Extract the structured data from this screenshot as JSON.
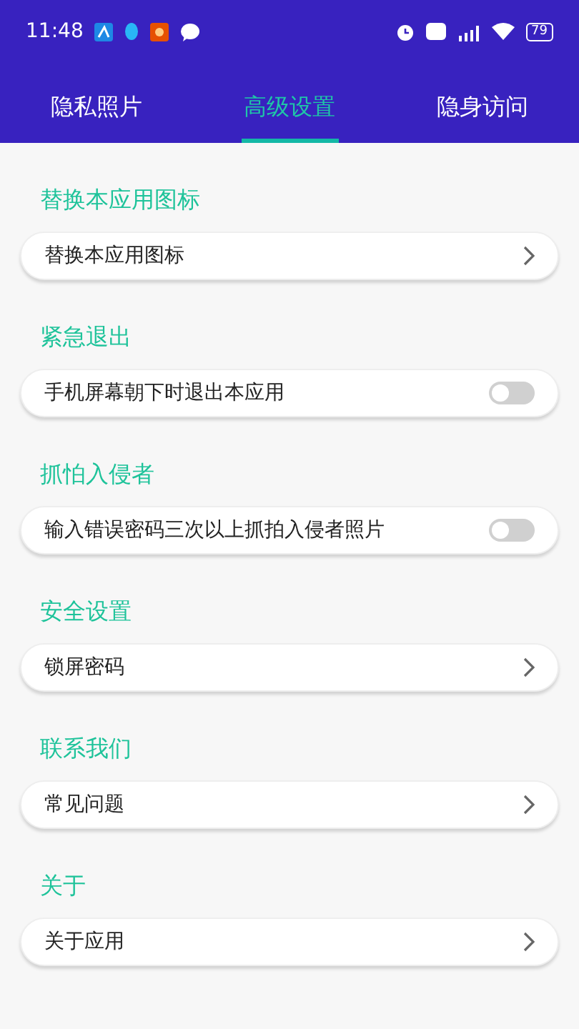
{
  "status_bar": {
    "time": "11:48",
    "battery": "79"
  },
  "tabs": [
    {
      "label": "隐私照片",
      "selected": false
    },
    {
      "label": "高级设置",
      "selected": true
    },
    {
      "label": "隐身访问",
      "selected": false
    }
  ],
  "sections": [
    {
      "title": "替换本应用图标",
      "item": {
        "kind": "link",
        "label": "替换本应用图标"
      }
    },
    {
      "title": "紧急退出",
      "item": {
        "kind": "toggle",
        "label": "手机屏幕朝下时退出本应用",
        "on": false
      }
    },
    {
      "title": "抓怕入侵者",
      "item": {
        "kind": "toggle",
        "label": "输入错误密码三次以上抓拍入侵者照片",
        "on": false
      }
    },
    {
      "title": "安全设置",
      "item": {
        "kind": "link",
        "label": "锁屏密码"
      }
    },
    {
      "title": "联系我们",
      "item": {
        "kind": "link",
        "label": "常见问题"
      }
    },
    {
      "title": "关于",
      "item": {
        "kind": "link",
        "label": "关于应用"
      }
    }
  ]
}
